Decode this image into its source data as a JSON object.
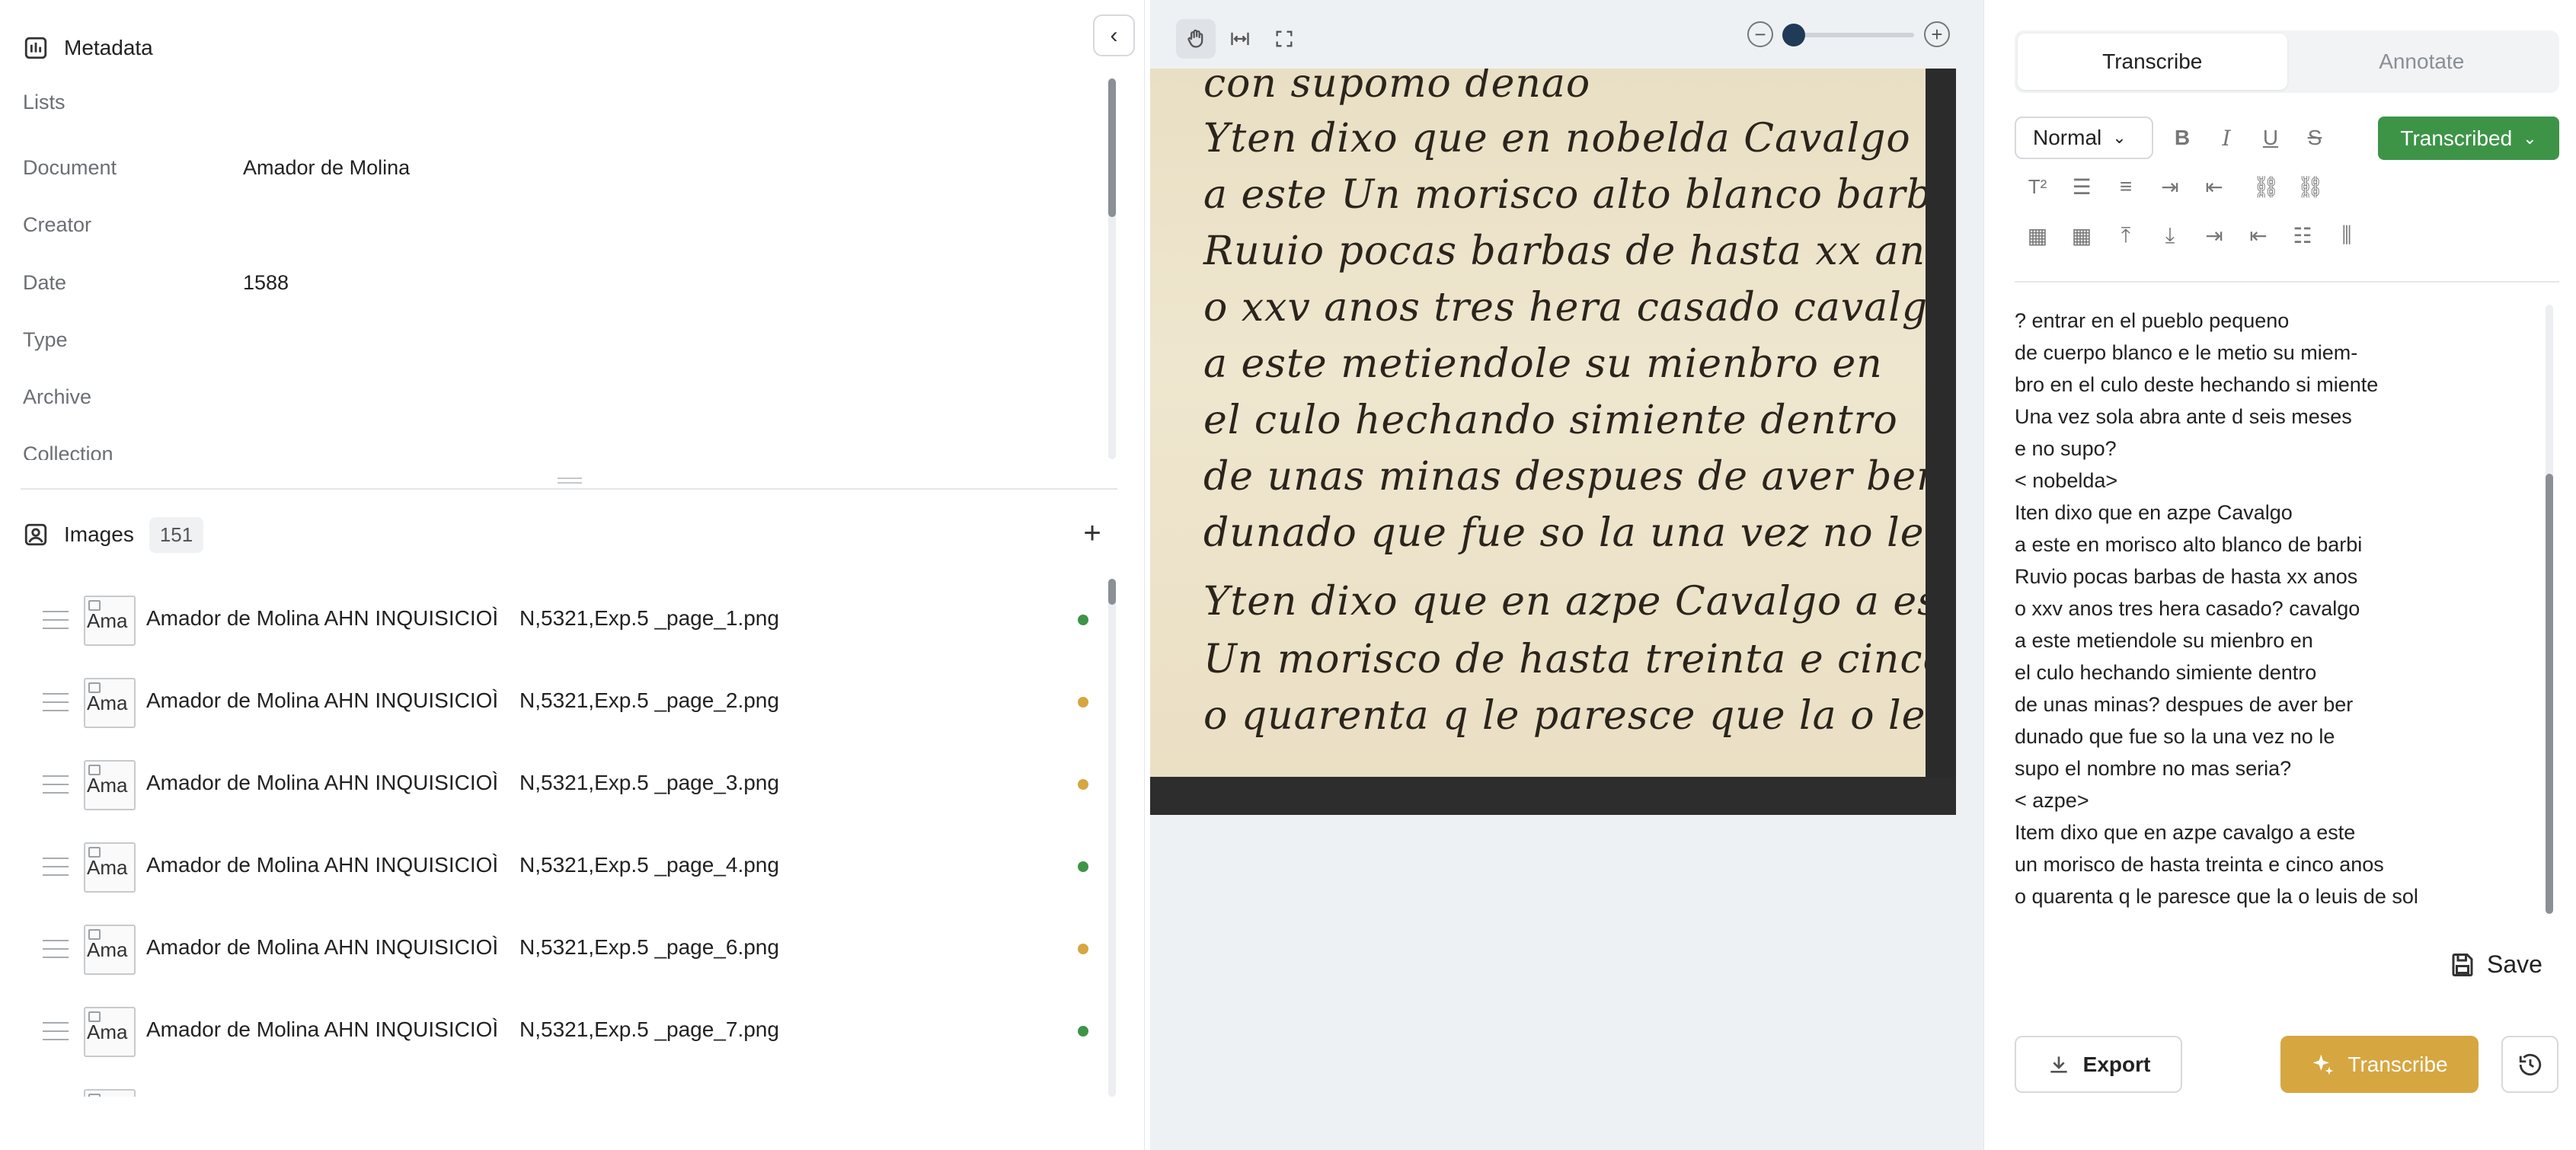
{
  "metadata": {
    "title": "Metadata",
    "fields": [
      {
        "label": "Lists",
        "value": ""
      },
      {
        "label": "Document",
        "value": "Amador de Molina"
      },
      {
        "label": "Creator",
        "value": ""
      },
      {
        "label": "Date",
        "value": "1588"
      },
      {
        "label": "Type",
        "value": ""
      },
      {
        "label": "Archive",
        "value": ""
      },
      {
        "label": "Collection",
        "value": ""
      }
    ]
  },
  "images": {
    "title": "Images",
    "count": "151",
    "items": [
      {
        "thumb_alt": "Ama",
        "name_a": "Amador de Molina AHN INQUISICIOÌ",
        "name_b": "N,5321,Exp.5 _page_1.png",
        "status_color": "#3d9447"
      },
      {
        "thumb_alt": "Ama",
        "name_a": "Amador de Molina AHN INQUISICIOÌ",
        "name_b": "N,5321,Exp.5 _page_2.png",
        "status_color": "#d6a640"
      },
      {
        "thumb_alt": "Ama",
        "name_a": "Amador de Molina AHN INQUISICIOÌ",
        "name_b": "N,5321,Exp.5 _page_3.png",
        "status_color": "#d6a640"
      },
      {
        "thumb_alt": "Ama",
        "name_a": "Amador de Molina AHN INQUISICIOÌ",
        "name_b": "N,5321,Exp.5 _page_4.png",
        "status_color": "#3d9447"
      },
      {
        "thumb_alt": "Ama",
        "name_a": "Amador de Molina AHN INQUISICIOÌ",
        "name_b": "N,5321,Exp.5 _page_6.png",
        "status_color": "#d6a640"
      },
      {
        "thumb_alt": "Ama",
        "name_a": "Amador de Molina AHN INQUISICIOÌ",
        "name_b": "N,5321,Exp.5 _page_7.png",
        "status_color": "#3d9447"
      }
    ]
  },
  "viewer": {
    "manuscript_lines": [
      "con supomo denao",
      "Yten dixo que en nobelda Cavalgo",
      "a este Un morisco alto blanco barbi",
      "Ruuio pocas barbas de hasta xx anos",
      "o xxv anos tres hera casado cavalgo",
      "a este metiendole su mienbro en",
      "el culo hechando simiente dentro",
      "de unas minas despues de aver ber",
      "dunado que fue so la una vez no le",
      "Yten dixo que en azpe Cavalgo a este",
      "Un morisco de hasta treinta e cinco",
      "o quarenta q le paresce que la o leuis"
    ]
  },
  "editor": {
    "tabs": [
      "Transcribe",
      "Annotate"
    ],
    "active_tab": "Transcribe",
    "format": "Normal",
    "status": "Transcribed",
    "lines": [
      "? entrar en el pueblo pequeno",
      "de cuerpo blanco e le metio su miem-",
      "bro en el culo deste hechando si miente",
      "Una vez sola abra ante d seis meses",
      "e no supo?",
      "< nobelda>",
      "Iten dixo que en azpe Cavalgo",
      "a este en morisco alto blanco de barbi",
      "Ruvio pocas barbas de hasta xx anos",
      "o xxv anos tres hera casado? cavalgo",
      "a este metiendole su mienbro en",
      "el culo hechando simiente dentro",
      "de unas minas? despues de aver ber",
      "dunado que fue so la una vez no le",
      "supo el nombre no mas seria?",
      "< azpe>",
      "Item dixo que en azpe cavalgo a este",
      "un morisco de hasta treinta e cinco anos",
      "o quarenta q le paresce que la o leuis de sol"
    ],
    "save_label": "Save",
    "export_label": "Export",
    "transcribe_label": "Transcribe"
  }
}
